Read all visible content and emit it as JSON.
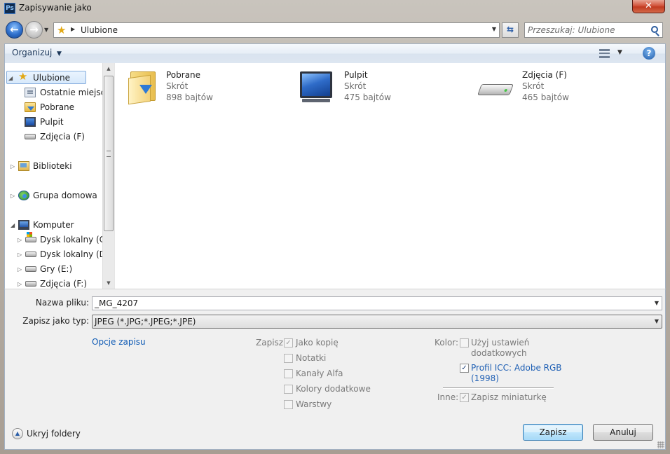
{
  "window": {
    "title": "Zapisywanie jako",
    "app_icon": "Ps",
    "close_glyph": "✕"
  },
  "nav": {
    "back_glyph": "←",
    "forward_glyph": "→",
    "address_crumb": "Ulubione",
    "search_placeholder": "Przeszukaj: Ulubione"
  },
  "toolbar": {
    "organize_label": "Organizuj",
    "help_glyph": "?"
  },
  "sidebar": {
    "items": [
      {
        "label": "Ulubione",
        "icon": "star-icon"
      },
      {
        "label": "Ostatnie miejsca",
        "icon": "recent-places-icon"
      },
      {
        "label": "Pobrane",
        "icon": "downloads-folder-icon"
      },
      {
        "label": "Pulpit",
        "icon": "desktop-icon"
      },
      {
        "label": "Zdjęcia (F)",
        "icon": "drive-icon"
      },
      {
        "label": "Biblioteki",
        "icon": "libraries-icon"
      },
      {
        "label": "Grupa domowa",
        "icon": "homegroup-icon"
      },
      {
        "label": "Komputer",
        "icon": "computer-icon"
      },
      {
        "label": "Dysk lokalny (C:)",
        "icon": "system-drive-icon"
      },
      {
        "label": "Dysk lokalny (D:)",
        "icon": "drive-icon"
      },
      {
        "label": "Gry (E:)",
        "icon": "drive-icon"
      },
      {
        "label": "Zdjęcia (F:)",
        "icon": "drive-icon"
      }
    ]
  },
  "files": [
    {
      "name": "Pobrane",
      "type": "Skrót",
      "size": "898 bajtów",
      "icon": "downloads-folder-icon"
    },
    {
      "name": "Pulpit",
      "type": "Skrót",
      "size": "475 bajtów",
      "icon": "desktop-icon"
    },
    {
      "name": "Zdjęcia (F)",
      "type": "Skrót",
      "size": "465 bajtów",
      "icon": "drive-icon"
    }
  ],
  "form": {
    "filename_label": "Nazwa pliku:",
    "filename_value": "_MG_4207",
    "filetype_label": "Zapisz jako typ:",
    "filetype_value": "JPEG (*.JPG;*.JPEG;*.JPE)",
    "save_options_link": "Opcje zapisu"
  },
  "save_options": {
    "label": "Zapisz:",
    "items": [
      {
        "label": "Jako kopię",
        "checked": true
      },
      {
        "label": "Notatki",
        "checked": false
      },
      {
        "label": "Kanały Alfa",
        "checked": false
      },
      {
        "label": "Kolory dodatkowe",
        "checked": false
      },
      {
        "label": "Warstwy",
        "checked": false
      }
    ]
  },
  "color_options": {
    "label": "Kolor:",
    "proof_line1": "Użyj ustawień",
    "proof_line2": "dodatkowych",
    "icc_line1": "Profil ICC:  Adobe RGB",
    "icc_line2": "(1998)",
    "icc_checked": true
  },
  "other_options": {
    "label": "Inne:",
    "thumbnail": "Zapisz miniaturkę",
    "thumbnail_checked": true
  },
  "footer": {
    "hide_folders": "Ukryj foldery",
    "save_button": "Zapisz",
    "cancel_button": "Anuluj"
  },
  "check_glyph": "✓"
}
